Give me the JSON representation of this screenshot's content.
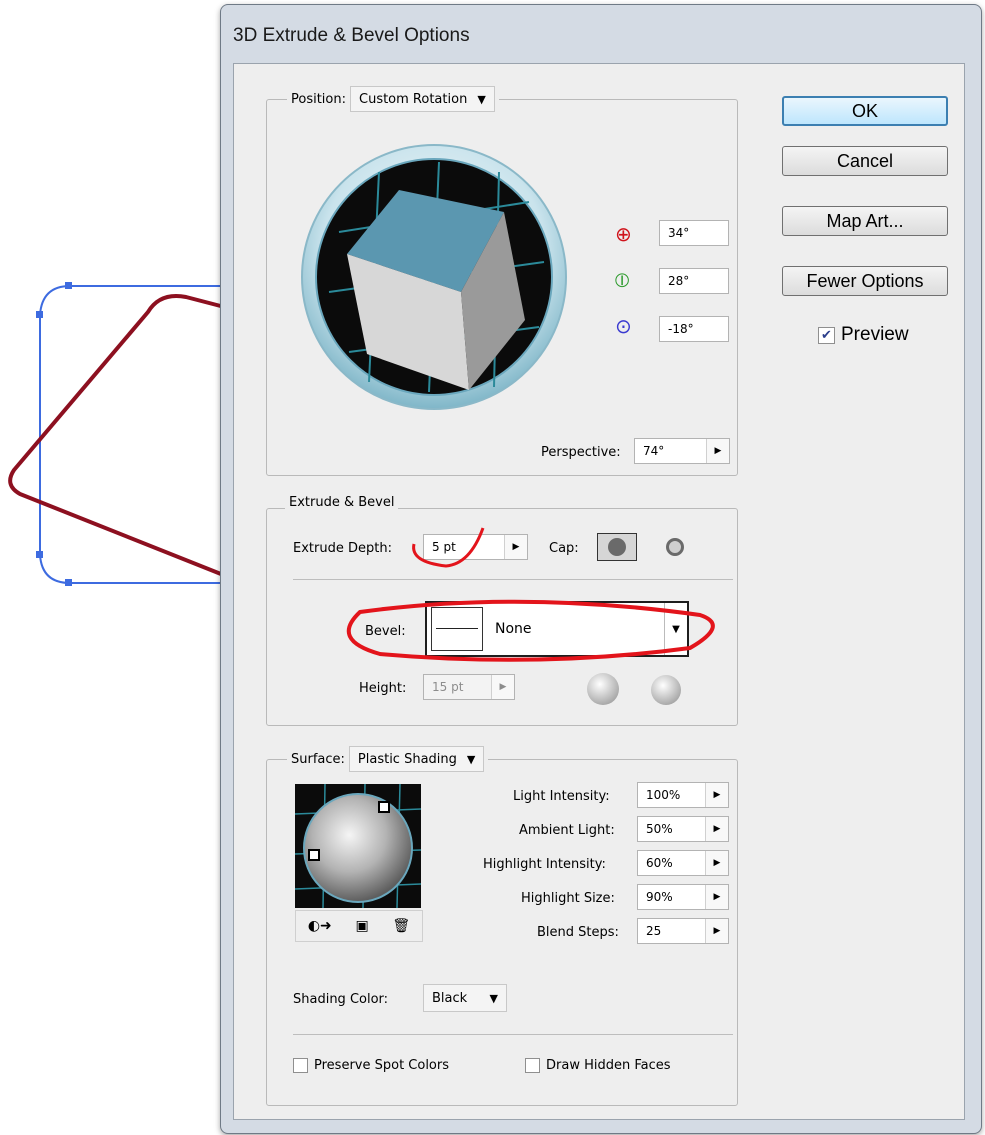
{
  "window": {
    "title": "3D Extrude & Bevel Options"
  },
  "buttons": {
    "ok": "OK",
    "cancel": "Cancel",
    "map_art": "Map Art...",
    "fewer_options": "Fewer Options"
  },
  "preview": {
    "label": "Preview",
    "checked": true
  },
  "position": {
    "label": "Position:",
    "value": "Custom Rotation",
    "x_rotation": "34°",
    "y_rotation": "28°",
    "z_rotation": "-18°",
    "perspective_label": "Perspective:",
    "perspective_value": "74°"
  },
  "extrude_bevel": {
    "group_label": "Extrude & Bevel",
    "depth_label": "Extrude Depth:",
    "depth_value": "5 pt",
    "cap_label": "Cap:",
    "bevel_label": "Bevel:",
    "bevel_value": "None",
    "height_label": "Height:",
    "height_value": "15 pt"
  },
  "surface": {
    "label": "Surface:",
    "value": "Plastic Shading",
    "light_intensity_label": "Light Intensity:",
    "light_intensity": "100%",
    "ambient_light_label": "Ambient Light:",
    "ambient_light": "50%",
    "highlight_intensity_label": "Highlight Intensity:",
    "highlight_intensity": "60%",
    "highlight_size_label": "Highlight Size:",
    "highlight_size": "90%",
    "blend_steps_label": "Blend Steps:",
    "blend_steps": "25",
    "shading_color_label": "Shading Color:",
    "shading_color": "Black"
  },
  "options": {
    "preserve_spot_colors": "Preserve Spot Colors",
    "draw_hidden_faces": "Draw Hidden Faces"
  },
  "colors": {
    "accent": "#3c7fb1",
    "cube_top": "#5b97b0",
    "annotation_red": "#e3141b",
    "artwork_red": "#8d1020",
    "selection_blue": "#3d6be0"
  }
}
